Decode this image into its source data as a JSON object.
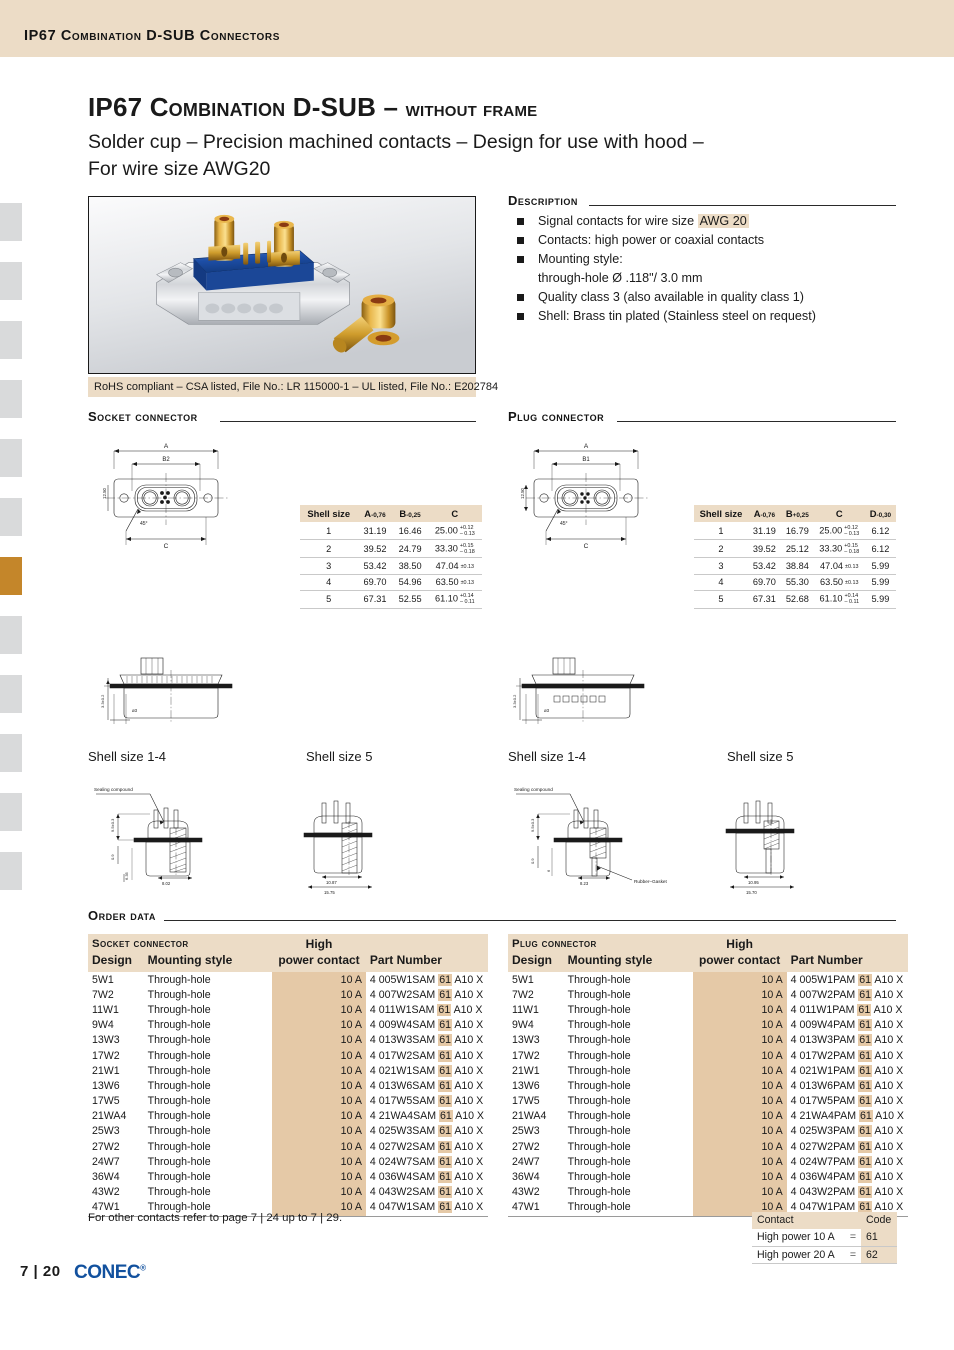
{
  "header": {
    "running_title": "IP67 Combination D-SUB Connectors"
  },
  "title": {
    "main_caps": "IP67 Combination D-SUB – ",
    "main_tail": "without frame",
    "subtitle_line1": "Solder cup – Precision machined contacts – Design for use with hood –",
    "subtitle_line2": "For wire size AWG20"
  },
  "photo": {
    "caption": "RoHS compliant – CSA listed, File No.: LR 115000-1 – UL listed, File No.: E202784"
  },
  "description": {
    "heading": "Description",
    "items": [
      {
        "pre": "Signal contacts for wire size ",
        "highlight": "AWG 20",
        "post": ""
      },
      {
        "pre": "Contacts: high power or coaxial contacts",
        "highlight": "",
        "post": ""
      },
      {
        "pre": "Mounting style:",
        "highlight": "",
        "post": ""
      },
      {
        "pre": "through-hole Ø .118\"/ 3.0 mm",
        "highlight": "",
        "post": "",
        "nobullet": true
      },
      {
        "pre": "Quality class 3 (also available in quality class 1)",
        "highlight": "",
        "post": ""
      },
      {
        "pre": "Shell: Brass tin plated (Stainless steel on request)",
        "highlight": "",
        "post": ""
      }
    ]
  },
  "socket_section": {
    "heading": "Socket connector"
  },
  "plug_section": {
    "heading": "Plug connector"
  },
  "socket_dims": {
    "columns": [
      "Shell size",
      "A",
      "B",
      "C"
    ],
    "col_tolerances": [
      "",
      "-0,76",
      "-0,25",
      ""
    ],
    "rows": [
      {
        "shell": "1",
        "a": "31.19",
        "b": "16.46",
        "c": "25.00",
        "c_up": "+0.12",
        "c_dn": "– 0.13"
      },
      {
        "shell": "2",
        "a": "39.52",
        "b": "24.79",
        "c": "33.30",
        "c_up": "+0.15",
        "c_dn": "– 0.18"
      },
      {
        "shell": "3",
        "a": "53.42",
        "b": "38.50",
        "c": "47.04",
        "c_up": "±0.13",
        "c_dn": ""
      },
      {
        "shell": "4",
        "a": "69.70",
        "b": "54.96",
        "c": "63.50",
        "c_up": "±0.13",
        "c_dn": ""
      },
      {
        "shell": "5",
        "a": "67.31",
        "b": "52.55",
        "c": "61.10",
        "c_up": "+0.14",
        "c_dn": "– 0.11"
      }
    ]
  },
  "plug_dims": {
    "columns": [
      "Shell size",
      "A",
      "B",
      "C",
      "D"
    ],
    "col_tolerances": [
      "",
      "-0,76",
      "+0,25",
      "",
      "-0,30"
    ],
    "rows": [
      {
        "shell": "1",
        "a": "31.19",
        "b": "16.79",
        "c": "25.00",
        "c_up": "+0.12",
        "c_dn": "– 0.13",
        "d": "6.12"
      },
      {
        "shell": "2",
        "a": "39.52",
        "b": "25.12",
        "c": "33.30",
        "c_up": "+0.15",
        "c_dn": "– 0.18",
        "d": "6.12"
      },
      {
        "shell": "3",
        "a": "53.42",
        "b": "38.84",
        "c": "47.04",
        "c_up": "±0.13",
        "c_dn": "",
        "d": "5.99"
      },
      {
        "shell": "4",
        "a": "69.70",
        "b": "55.30",
        "c": "63.50",
        "c_up": "±0.13",
        "c_dn": "",
        "d": "5.99"
      },
      {
        "shell": "5",
        "a": "67.31",
        "b": "52.68",
        "c": "61.10",
        "c_up": "+0.14",
        "c_dn": "– 0.11",
        "d": "5.99"
      }
    ]
  },
  "drawing_labels": {
    "socket_shell_1_4": "Shell size 1-4",
    "socket_shell_5": "Shell size 5",
    "plug_shell_1_4": "Shell size 1-4",
    "plug_shell_5": "Shell size 5",
    "sealing_compound": "Sealing compound",
    "rubber_gasket": "Rubber-Gasket",
    "dim_a": "A",
    "dim_b1": "B1",
    "dim_b2": "B2",
    "dim_c": "C",
    "angle": "45°"
  },
  "order_data": {
    "heading": "Order data",
    "socket": {
      "title": "Socket connector",
      "columns": {
        "design": "Design",
        "mounting": "Mounting style",
        "power_l1": "High",
        "power_l2": "power contact",
        "part": "Part Number"
      },
      "rows": [
        {
          "design": "5W1",
          "mounting": "Through-hole",
          "power": "10 A",
          "pn_pre": "4 005W1SAM",
          "pn_code": "61",
          "pn_post": "A10 X"
        },
        {
          "design": "7W2",
          "mounting": "Through-hole",
          "power": "10 A",
          "pn_pre": "4 007W2SAM",
          "pn_code": "61",
          "pn_post": "A10 X"
        },
        {
          "design": "11W1",
          "mounting": "Through-hole",
          "power": "10 A",
          "pn_pre": "4 011W1SAM",
          "pn_code": "61",
          "pn_post": "A10 X"
        },
        {
          "design": "9W4",
          "mounting": "Through-hole",
          "power": "10 A",
          "pn_pre": "4 009W4SAM",
          "pn_code": "61",
          "pn_post": "A10 X"
        },
        {
          "design": "13W3",
          "mounting": "Through-hole",
          "power": "10 A",
          "pn_pre": "4 013W3SAM",
          "pn_code": "61",
          "pn_post": "A10 X"
        },
        {
          "design": "17W2",
          "mounting": "Through-hole",
          "power": "10 A",
          "pn_pre": "4 017W2SAM",
          "pn_code": "61",
          "pn_post": "A10 X"
        },
        {
          "design": "21W1",
          "mounting": "Through-hole",
          "power": "10 A",
          "pn_pre": "4 021W1SAM",
          "pn_code": "61",
          "pn_post": "A10 X"
        },
        {
          "design": "13W6",
          "mounting": "Through-hole",
          "power": "10 A",
          "pn_pre": "4 013W6SAM",
          "pn_code": "61",
          "pn_post": "A10 X"
        },
        {
          "design": "17W5",
          "mounting": "Through-hole",
          "power": "10 A",
          "pn_pre": "4 017W5SAM",
          "pn_code": "61",
          "pn_post": "A10 X"
        },
        {
          "design": "21WA4",
          "mounting": "Through-hole",
          "power": "10 A",
          "pn_pre": "4 21WA4SAM",
          "pn_code": "61",
          "pn_post": "A10 X"
        },
        {
          "design": "25W3",
          "mounting": "Through-hole",
          "power": "10 A",
          "pn_pre": "4 025W3SAM",
          "pn_code": "61",
          "pn_post": "A10 X"
        },
        {
          "design": "27W2",
          "mounting": "Through-hole",
          "power": "10 A",
          "pn_pre": "4 027W2SAM",
          "pn_code": "61",
          "pn_post": "A10 X"
        },
        {
          "design": "24W7",
          "mounting": "Through-hole",
          "power": "10 A",
          "pn_pre": "4 024W7SAM",
          "pn_code": "61",
          "pn_post": "A10 X"
        },
        {
          "design": "36W4",
          "mounting": "Through-hole",
          "power": "10 A",
          "pn_pre": "4 036W4SAM",
          "pn_code": "61",
          "pn_post": "A10 X"
        },
        {
          "design": "43W2",
          "mounting": "Through-hole",
          "power": "10 A",
          "pn_pre": "4 043W2SAM",
          "pn_code": "61",
          "pn_post": "A10 X"
        },
        {
          "design": "47W1",
          "mounting": "Through-hole",
          "power": "10 A",
          "pn_pre": "4 047W1SAM",
          "pn_code": "61",
          "pn_post": "A10 X"
        }
      ]
    },
    "plug": {
      "title": "Plug connector",
      "columns": {
        "design": "Design",
        "mounting": "Mounting style",
        "power_l1": "High",
        "power_l2": "power contact",
        "part": "Part Number"
      },
      "rows": [
        {
          "design": "5W1",
          "mounting": "Through-hole",
          "power": "10 A",
          "pn_pre": "4 005W1PAM",
          "pn_code": "61",
          "pn_post": "A10 X"
        },
        {
          "design": "7W2",
          "mounting": "Through-hole",
          "power": "10 A",
          "pn_pre": "4 007W2PAM",
          "pn_code": "61",
          "pn_post": "A10 X"
        },
        {
          "design": "11W1",
          "mounting": "Through-hole",
          "power": "10 A",
          "pn_pre": "4 011W1PAM",
          "pn_code": "61",
          "pn_post": "A10 X"
        },
        {
          "design": "9W4",
          "mounting": "Through-hole",
          "power": "10 A",
          "pn_pre": "4 009W4PAM",
          "pn_code": "61",
          "pn_post": "A10 X"
        },
        {
          "design": "13W3",
          "mounting": "Through-hole",
          "power": "10 A",
          "pn_pre": "4 013W3PAM",
          "pn_code": "61",
          "pn_post": "A10 X"
        },
        {
          "design": "17W2",
          "mounting": "Through-hole",
          "power": "10 A",
          "pn_pre": "4 017W2PAM",
          "pn_code": "61",
          "pn_post": "A10 X"
        },
        {
          "design": "21W1",
          "mounting": "Through-hole",
          "power": "10 A",
          "pn_pre": "4 021W1PAM",
          "pn_code": "61",
          "pn_post": "A10 X"
        },
        {
          "design": "13W6",
          "mounting": "Through-hole",
          "power": "10 A",
          "pn_pre": "4 013W6PAM",
          "pn_code": "61",
          "pn_post": "A10 X"
        },
        {
          "design": "17W5",
          "mounting": "Through-hole",
          "power": "10 A",
          "pn_pre": "4 017W5PAM",
          "pn_code": "61",
          "pn_post": "A10 X"
        },
        {
          "design": "21WA4",
          "mounting": "Through-hole",
          "power": "10 A",
          "pn_pre": "4 21WA4PAM",
          "pn_code": "61",
          "pn_post": "A10 X"
        },
        {
          "design": "25W3",
          "mounting": "Through-hole",
          "power": "10 A",
          "pn_pre": "4 025W3PAM",
          "pn_code": "61",
          "pn_post": "A10 X"
        },
        {
          "design": "27W2",
          "mounting": "Through-hole",
          "power": "10 A",
          "pn_pre": "4 027W2PAM",
          "pn_code": "61",
          "pn_post": "A10 X"
        },
        {
          "design": "24W7",
          "mounting": "Through-hole",
          "power": "10 A",
          "pn_pre": "4 024W7PAM",
          "pn_code": "61",
          "pn_post": "A10 X"
        },
        {
          "design": "36W4",
          "mounting": "Through-hole",
          "power": "10 A",
          "pn_pre": "4 036W4PAM",
          "pn_code": "61",
          "pn_post": "A10 X"
        },
        {
          "design": "43W2",
          "mounting": "Through-hole",
          "power": "10 A",
          "pn_pre": "4 043W2PAM",
          "pn_code": "61",
          "pn_post": "A10 X"
        },
        {
          "design": "47W1",
          "mounting": "Through-hole",
          "power": "10 A",
          "pn_pre": "4 047W1PAM",
          "pn_code": "61",
          "pn_post": "A10 X"
        }
      ]
    },
    "footnote": "For other contacts refer to page 7 | 24 up to 7 | 29."
  },
  "contact_codes": {
    "columns": {
      "contact": "Contact",
      "code": "Code"
    },
    "rows": [
      {
        "contact": "High power 10 A",
        "eq": "=",
        "code": "61"
      },
      {
        "contact": "High power 20 A",
        "eq": "=",
        "code": "62"
      }
    ]
  },
  "footer": {
    "page": "7 | 20",
    "brand": "CONEC",
    "brand_mark": "®"
  },
  "colors": {
    "banner": "#ecdcc6",
    "table_header": "#ecdcc6",
    "accent_band": "#e5c9a7",
    "tab_inactive": "#d9dadb",
    "tab_active": "#c4862a",
    "brand_blue": "#12519e"
  }
}
